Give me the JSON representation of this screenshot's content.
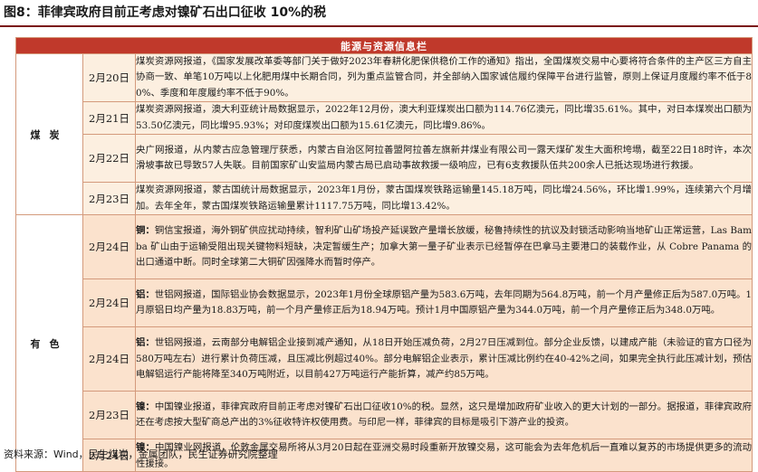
{
  "figure_title": "图8：菲律宾政府目前正考虑对镍矿石出口征收 10%的税",
  "table": {
    "header": "能源与资源信息栏",
    "categories": {
      "coal": "煤炭",
      "metals": "有色"
    },
    "rows": [
      {
        "date": "2月20日",
        "prefix": "",
        "text": "煤炭资源网报道，《国家发展改革委等部门关于做好2023年春耕化肥保供稳价工作的通知》指出，全国煤炭交易中心要将符合条件的主产区三方自主协商一致、单笔10万吨以上化肥用煤中长期合同，列为重点监管合同，并全部纳入国家诚信履约保障平台进行监管，原则上保证月度履约率不低于80%、季度和年度履约率不低于90%。"
      },
      {
        "date": "2月21日",
        "prefix": "",
        "text": "煤炭资源网报道，澳大利亚统计局数据显示，2022年12月份，澳大利亚煤炭出口额为114.76亿澳元，同比增35.61%。其中，对日本煤炭出口额为53.50亿澳元，同比增95.93%；对印度煤炭出口额为15.61亿澳元，同比增9.86%。"
      },
      {
        "date": "2月22日",
        "prefix": "",
        "text": "央广网报道，从内蒙古应急管理厅获悉，内蒙古自治区阿拉善盟阿拉善左旗新井煤业有限公司一露天煤矿发生大面积垮塌，截至22日18时许，本次滑坡事故已导致57人失联。目前国家矿山安监局内蒙古局已启动事故救援一级响应，已有6支救援队伍共200余人已抵达现场进行救援。"
      },
      {
        "date": "2月23日",
        "prefix": "",
        "text": "煤炭资源网报道，蒙古国统计局数据显示，2023年1月份，蒙古国煤炭铁路运输量145.18万吨，同比增24.56%，环比增1.99%，连续第六个月增加。去年全年，蒙古国煤炭铁路运输量累计1117.75万吨，同比增13.42%。"
      },
      {
        "date": "2月24日",
        "prefix": "铜：",
        "text": "铜信宝报道，海外铜矿供应扰动持续，智利矿山矿场投产延误致产量增长放缓，秘鲁持续性的抗议及封锁活动影响当地矿山正常运营，Las Bamba 矿山由于运输受阻出现关键物料短缺，决定暂缓生产；加拿大第一量子矿业表示已经暂停在巴拿马主要港口的装载作业，从 Cobre Panama 的出口通道中断。同时全球第二大铜矿因强降水而暂时停产。"
      },
      {
        "date": "2月24日",
        "prefix": "铝：",
        "text": "世铝网报道，国际铝业协会数据显示，2023年1月份全球原铝产量为583.6万吨，去年同期为564.8万吨，前一个月产量修正后为587.0万吨。1月原铝日均产量为18.83万吨，前一个月产量修正后为18.94万吨。预计1月中国原铝产量为344.0万吨，前一个月产量修正后为348.0万吨。"
      },
      {
        "date": "2月24日",
        "prefix": "铝：",
        "text": "世铝网报道，云南部分电解铝企业接到减产通知，从18日开始压减负荷，2月27日压减到位。部分企业反馈，以建成产能（未验证的官方口径为580万吨左右）进行累计负荷压减，且压减比例超过40%。部分电解铝企业表示，累计压减比例约在40-42%之间，如果完全执行此压减计划，预估电解铝运行产能将降至340万吨附近，以目前427万吨运行产能折算，减产约85万吨。"
      },
      {
        "date": "2月23日",
        "prefix": "镍：",
        "text": "中国镍业报道，菲律宾政府目前正考虑对镍矿石出口征收10%的税。显然，这只是增加政府矿业收入的更大计划的一部分。据报道，菲律宾政府还在考虑按大型矿商总产出的3%征收特许权使用费。与印尼一样，菲律宾的目标是吸引下游产业的投资。"
      },
      {
        "date": "2月24日",
        "prefix": "镍：",
        "text": "中国镍业网报道，伦敦金属交易所将从3月20日起在亚洲交易时段重新开放镍交易，这可能会为去年危机后一直难以复苏的市场提供更多的流动性援接。"
      }
    ]
  },
  "source": "资料来源：Wind，民生煤炭，金属团队，民生证券研究院整理"
}
